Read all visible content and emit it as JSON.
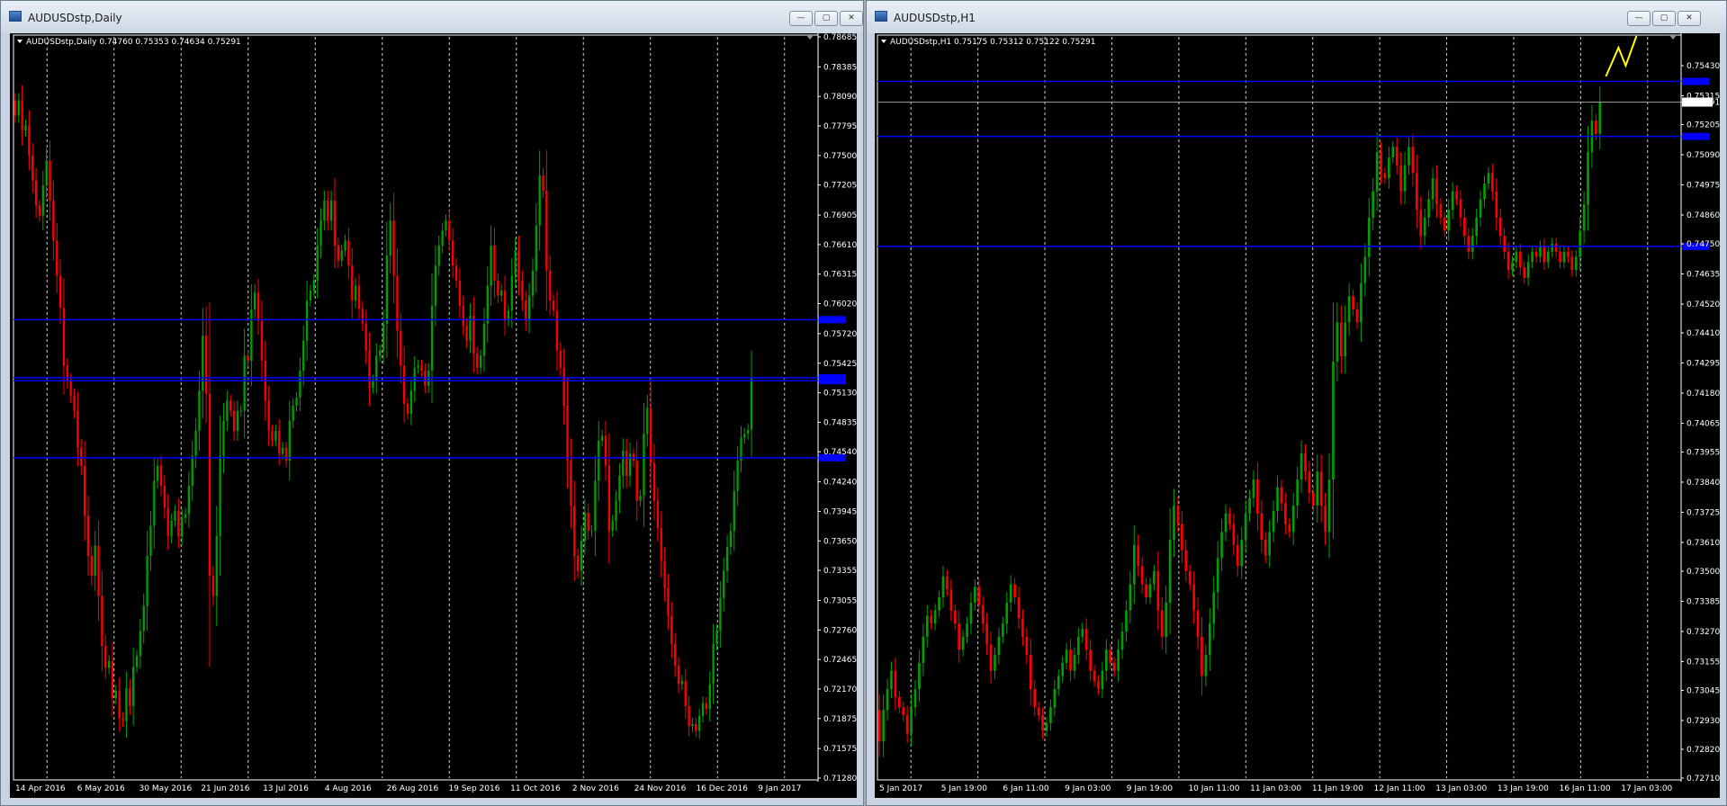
{
  "windows": [
    {
      "title": "AUDUSDstp,Daily",
      "controls": {
        "minimize": "—",
        "restore": "▢",
        "close": "✕"
      }
    },
    {
      "title": "AUDUSDstp,H1",
      "controls": {
        "minimize": "—",
        "restore": "▢",
        "close": "✕"
      }
    }
  ],
  "chart_data": [
    {
      "type": "candlestick",
      "header": "AUDUSDstp,Daily  0.74760 0.75353 0.74634 0.75291",
      "ylim": [
        0.7128,
        0.78685
      ],
      "y_ticks": [
        "0.78685",
        "0.78385",
        "0.78090",
        "0.77795",
        "0.77500",
        "0.77205",
        "0.76905",
        "0.76610",
        "0.76315",
        "0.76020",
        "0.75720",
        "0.75425",
        "0.75130",
        "0.74835",
        "0.74540",
        "0.74240",
        "0.73945",
        "0.73650",
        "0.73355",
        "0.73055",
        "0.72760",
        "0.72465",
        "0.72170",
        "0.71875",
        "0.71575",
        "0.71280"
      ],
      "x_ticks": [
        "14 Apr 2016",
        "6 May 2016",
        "30 May 2016",
        "21 Jun 2016",
        "13 Jul 2016",
        "4 Aug 2016",
        "26 Aug 2016",
        "19 Sep 2016",
        "11 Oct 2016",
        "2 Nov 2016",
        "24 Nov 2016",
        "16 Dec 2016",
        "9 Jan 2017"
      ],
      "hlines": [
        0.7586,
        0.7528,
        0.7525,
        0.7448
      ],
      "hline_color": "#0000ff",
      "bull_color": "#00a000",
      "bear_color": "#ff0000",
      "closes": [
        0.779,
        0.7805,
        0.7775,
        0.778,
        0.775,
        0.7725,
        0.77,
        0.769,
        0.772,
        0.7745,
        0.7705,
        0.7665,
        0.763,
        0.7598,
        0.754,
        0.7525,
        0.751,
        0.7495,
        0.7458,
        0.744,
        0.739,
        0.735,
        0.733,
        0.736,
        0.731,
        0.726,
        0.7238,
        0.7245,
        0.7208,
        0.7215,
        0.7188,
        0.7185,
        0.7218,
        0.72,
        0.7239,
        0.725,
        0.7275,
        0.73,
        0.735,
        0.738,
        0.7425,
        0.744,
        0.742,
        0.7398,
        0.737,
        0.7385,
        0.7395,
        0.737,
        0.7388,
        0.7392,
        0.742,
        0.745,
        0.7475,
        0.7515,
        0.757,
        0.7512,
        0.733,
        0.731,
        0.737,
        0.745,
        0.7485,
        0.7505,
        0.7495,
        0.7475,
        0.7495,
        0.7495,
        0.755,
        0.7545,
        0.7596,
        0.7613,
        0.7585,
        0.7545,
        0.7505,
        0.7475,
        0.7465,
        0.7475,
        0.7452,
        0.7458,
        0.7445,
        0.7485,
        0.75,
        0.7508,
        0.7535,
        0.7565,
        0.7605,
        0.7615,
        0.7625,
        0.766,
        0.7685,
        0.7705,
        0.7685,
        0.7705,
        0.766,
        0.7645,
        0.7655,
        0.7665,
        0.764,
        0.7605,
        0.762,
        0.7597,
        0.7582,
        0.7555,
        0.7518,
        0.7525,
        0.755,
        0.7555,
        0.7582,
        0.765,
        0.7685,
        0.763,
        0.7575,
        0.754,
        0.7502,
        0.7492,
        0.7515,
        0.7538,
        0.754,
        0.7535,
        0.752,
        0.7535,
        0.76,
        0.764,
        0.766,
        0.7675,
        0.7685,
        0.7665,
        0.764,
        0.7625,
        0.76,
        0.758,
        0.7565,
        0.759,
        0.7552,
        0.7538,
        0.755,
        0.7582,
        0.762,
        0.766,
        0.7625,
        0.761,
        0.7615,
        0.7585,
        0.7595,
        0.763,
        0.7655,
        0.7625,
        0.7605,
        0.7585,
        0.761,
        0.7635,
        0.768,
        0.773,
        0.7715,
        0.7635,
        0.7605,
        0.7595,
        0.7555,
        0.7538,
        0.75,
        0.7445,
        0.74,
        0.735,
        0.7335,
        0.7365,
        0.7393,
        0.7375,
        0.7375,
        0.7425,
        0.7465,
        0.747,
        0.744,
        0.7375,
        0.7385,
        0.7405,
        0.743,
        0.7455,
        0.743,
        0.7452,
        0.7445,
        0.7405,
        0.741,
        0.7472,
        0.7498,
        0.7443,
        0.7405,
        0.7378,
        0.7345,
        0.7318,
        0.729,
        0.7262,
        0.724,
        0.7222,
        0.7225,
        0.72,
        0.718,
        0.7182,
        0.7175,
        0.719,
        0.7203,
        0.7197,
        0.7222,
        0.7262,
        0.7275,
        0.7308,
        0.7335,
        0.7359,
        0.7375,
        0.7415,
        0.7445,
        0.7468,
        0.7472,
        0.7476,
        0.7529
      ]
    },
    {
      "type": "candlestick",
      "header": "AUDUSDstp,H1  0.75175 0.75312 0.75122 0.75291",
      "ylim": [
        0.7271,
        0.7554
      ],
      "y_ticks": [
        "0.75430",
        "0.75315",
        "0.75291",
        "0.75205",
        "0.75090",
        "0.74975",
        "0.74860",
        "0.74750",
        "0.74635",
        "0.74520",
        "0.74410",
        "0.74295",
        "0.74180",
        "0.74065",
        "0.73955",
        "0.73840",
        "0.73725",
        "0.73610",
        "0.73500",
        "0.73385",
        "0.73270",
        "0.73155",
        "0.73045",
        "0.72930",
        "0.72820",
        "0.72710"
      ],
      "x_ticks": [
        "5 Jan 2017",
        "5 Jan 19:00",
        "6 Jan 11:00",
        "9 Jan 03:00",
        "9 Jan 19:00",
        "10 Jan 11:00",
        "11 Jan 03:00",
        "11 Jan 19:00",
        "12 Jan 11:00",
        "13 Jan 03:00",
        "13 Jan 19:00",
        "16 Jan 11:00",
        "17 Jan 03:00"
      ],
      "hlines": [
        0.7537,
        0.7516,
        0.7474
      ],
      "price_line": 0.75291,
      "hline_color": "#0000ff",
      "bull_color": "#00a000",
      "bear_color": "#ff0000",
      "annotation_color": "#ffff00",
      "closes": [
        0.7285,
        0.7297,
        0.7305,
        0.7312,
        0.7302,
        0.7298,
        0.7295,
        0.7288,
        0.7298,
        0.7305,
        0.7315,
        0.7325,
        0.7333,
        0.733,
        0.7335,
        0.734,
        0.7348,
        0.7343,
        0.7335,
        0.733,
        0.732,
        0.7325,
        0.733,
        0.7338,
        0.7344,
        0.7337,
        0.733,
        0.7322,
        0.7312,
        0.7318,
        0.7325,
        0.733,
        0.7338,
        0.7345,
        0.734,
        0.7332,
        0.7325,
        0.7318,
        0.7305,
        0.7298,
        0.7295,
        0.7289,
        0.7292,
        0.7298,
        0.7305,
        0.731,
        0.7315,
        0.732,
        0.7312,
        0.7318,
        0.7325,
        0.7328,
        0.732,
        0.7312,
        0.7308,
        0.7305,
        0.7312,
        0.732,
        0.7315,
        0.7312,
        0.732,
        0.7327,
        0.7335,
        0.7345,
        0.736,
        0.7352,
        0.7345,
        0.734,
        0.7345,
        0.735,
        0.7335,
        0.7325,
        0.7338,
        0.7362,
        0.7375,
        0.7368,
        0.7358,
        0.735,
        0.7345,
        0.7335,
        0.7325,
        0.731,
        0.7318,
        0.733,
        0.7342,
        0.7355,
        0.7365,
        0.7372,
        0.7368,
        0.736,
        0.7352,
        0.7362,
        0.7372,
        0.7378,
        0.7385,
        0.7372,
        0.7362,
        0.7356,
        0.7365,
        0.7373,
        0.7382,
        0.7376,
        0.7368,
        0.7365,
        0.7375,
        0.7385,
        0.7395,
        0.7388,
        0.738,
        0.7375,
        0.7388,
        0.7375,
        0.7365,
        0.7385,
        0.743,
        0.7445,
        0.7432,
        0.7445,
        0.7455,
        0.745,
        0.7445,
        0.746,
        0.747,
        0.7485,
        0.7495,
        0.751,
        0.7502,
        0.75,
        0.7508,
        0.7512,
        0.7505,
        0.7495,
        0.7505,
        0.7512,
        0.7502,
        0.7488,
        0.7478,
        0.7485,
        0.7492,
        0.75,
        0.749,
        0.7485,
        0.748,
        0.7488,
        0.7495,
        0.7492,
        0.7485,
        0.7478,
        0.7472,
        0.7478,
        0.7485,
        0.7492,
        0.7498,
        0.7502,
        0.7495,
        0.7485,
        0.7478,
        0.7472,
        0.7465,
        0.7468,
        0.7472,
        0.7466,
        0.7462,
        0.7468,
        0.7472,
        0.747,
        0.7474,
        0.7468,
        0.7472,
        0.7475,
        0.7472,
        0.7468,
        0.7472,
        0.747,
        0.7465,
        0.747,
        0.748,
        0.749,
        0.751,
        0.7522,
        0.7517,
        0.7529
      ]
    }
  ]
}
